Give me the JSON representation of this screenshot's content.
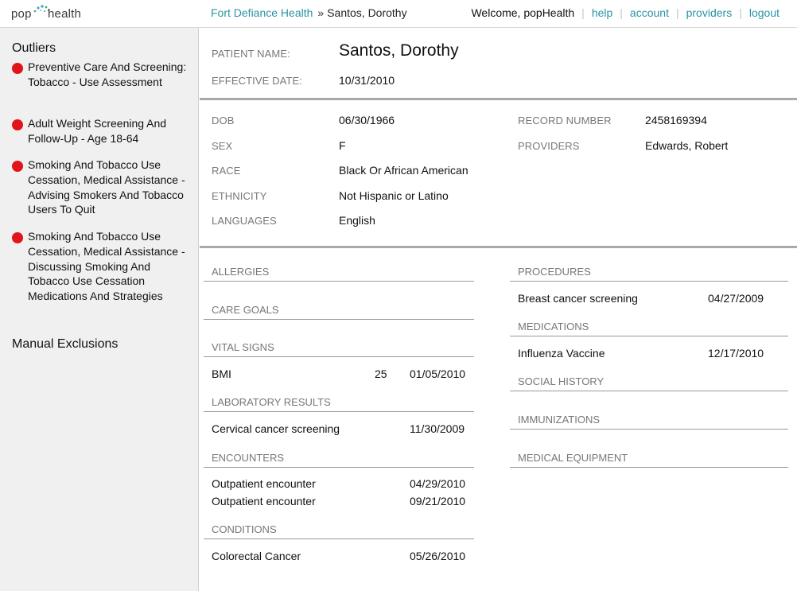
{
  "header": {
    "logo": {
      "left": "pop",
      "right": "health"
    },
    "breadcrumb": {
      "org": "Fort Defiance Health",
      "separator": "»",
      "patient": "Santos, Dorothy"
    },
    "welcome": "Welcome, popHealth",
    "links": [
      "help",
      "account",
      "providers",
      "logout"
    ],
    "link_color": "#2a93a5"
  },
  "sidebar": {
    "outliers_title": "Outliers",
    "outliers": [
      "Preventive Care And Screening: Tobacco - Use Assessment",
      "Adult Weight Screening And Follow-Up - Age 18-64",
      "Smoking And Tobacco Use Cessation, Medical Assistance - Advising Smokers And Tobacco Users To Quit",
      "Smoking And Tobacco Use Cessation, Medical Assistance - Discussing Smoking And Tobacco Use Cessation Medications And Strategies"
    ],
    "outlier_dot_color": "#e0141a",
    "exclusions_title": "Manual Exclusions"
  },
  "patient": {
    "name_label": "PATIENT NAME:",
    "name": "Santos, Dorothy",
    "effective_label": "EFFECTIVE DATE:",
    "effective_date": "10/31/2010",
    "dob_label": "DOB",
    "dob": "06/30/1966",
    "sex_label": "SEX",
    "sex": "F",
    "race_label": "RACE",
    "race": "Black Or African American",
    "ethnicity_label": "ETHNICITY",
    "ethnicity": "Not Hispanic or Latino",
    "languages_label": "LANGUAGES",
    "languages": "English",
    "record_label": "RECORD NUMBER",
    "record_number": "2458169394",
    "providers_label": "PROVIDERS",
    "providers": "Edwards, Robert"
  },
  "sections": {
    "allergies": {
      "title": "ALLERGIES"
    },
    "care_goals": {
      "title": "CARE GOALS"
    },
    "vital_signs": {
      "title": "VITAL SIGNS",
      "rows": [
        {
          "name": "BMI",
          "value": "25",
          "date": "01/05/2010"
        }
      ]
    },
    "lab_results": {
      "title": "LABORATORY RESULTS",
      "rows": [
        {
          "name": "Cervical cancer screening",
          "date": "11/30/2009"
        }
      ]
    },
    "encounters": {
      "title": "ENCOUNTERS",
      "rows": [
        {
          "name": "Outpatient encounter",
          "date": "04/29/2010"
        },
        {
          "name": "Outpatient encounter",
          "date": "09/21/2010"
        }
      ]
    },
    "conditions": {
      "title": "CONDITIONS",
      "rows": [
        {
          "name": "Colorectal Cancer",
          "date": "05/26/2010"
        }
      ]
    },
    "procedures": {
      "title": "PROCEDURES",
      "rows": [
        {
          "name": "Breast cancer screening",
          "date": "04/27/2009"
        }
      ]
    },
    "medications": {
      "title": "MEDICATIONS",
      "rows": [
        {
          "name": "Influenza Vaccine",
          "date": "12/17/2010"
        }
      ]
    },
    "social_history": {
      "title": "SOCIAL HISTORY"
    },
    "immunizations": {
      "title": "IMMUNIZATIONS"
    },
    "medical_equipment": {
      "title": "MEDICAL EQUIPMENT"
    }
  }
}
